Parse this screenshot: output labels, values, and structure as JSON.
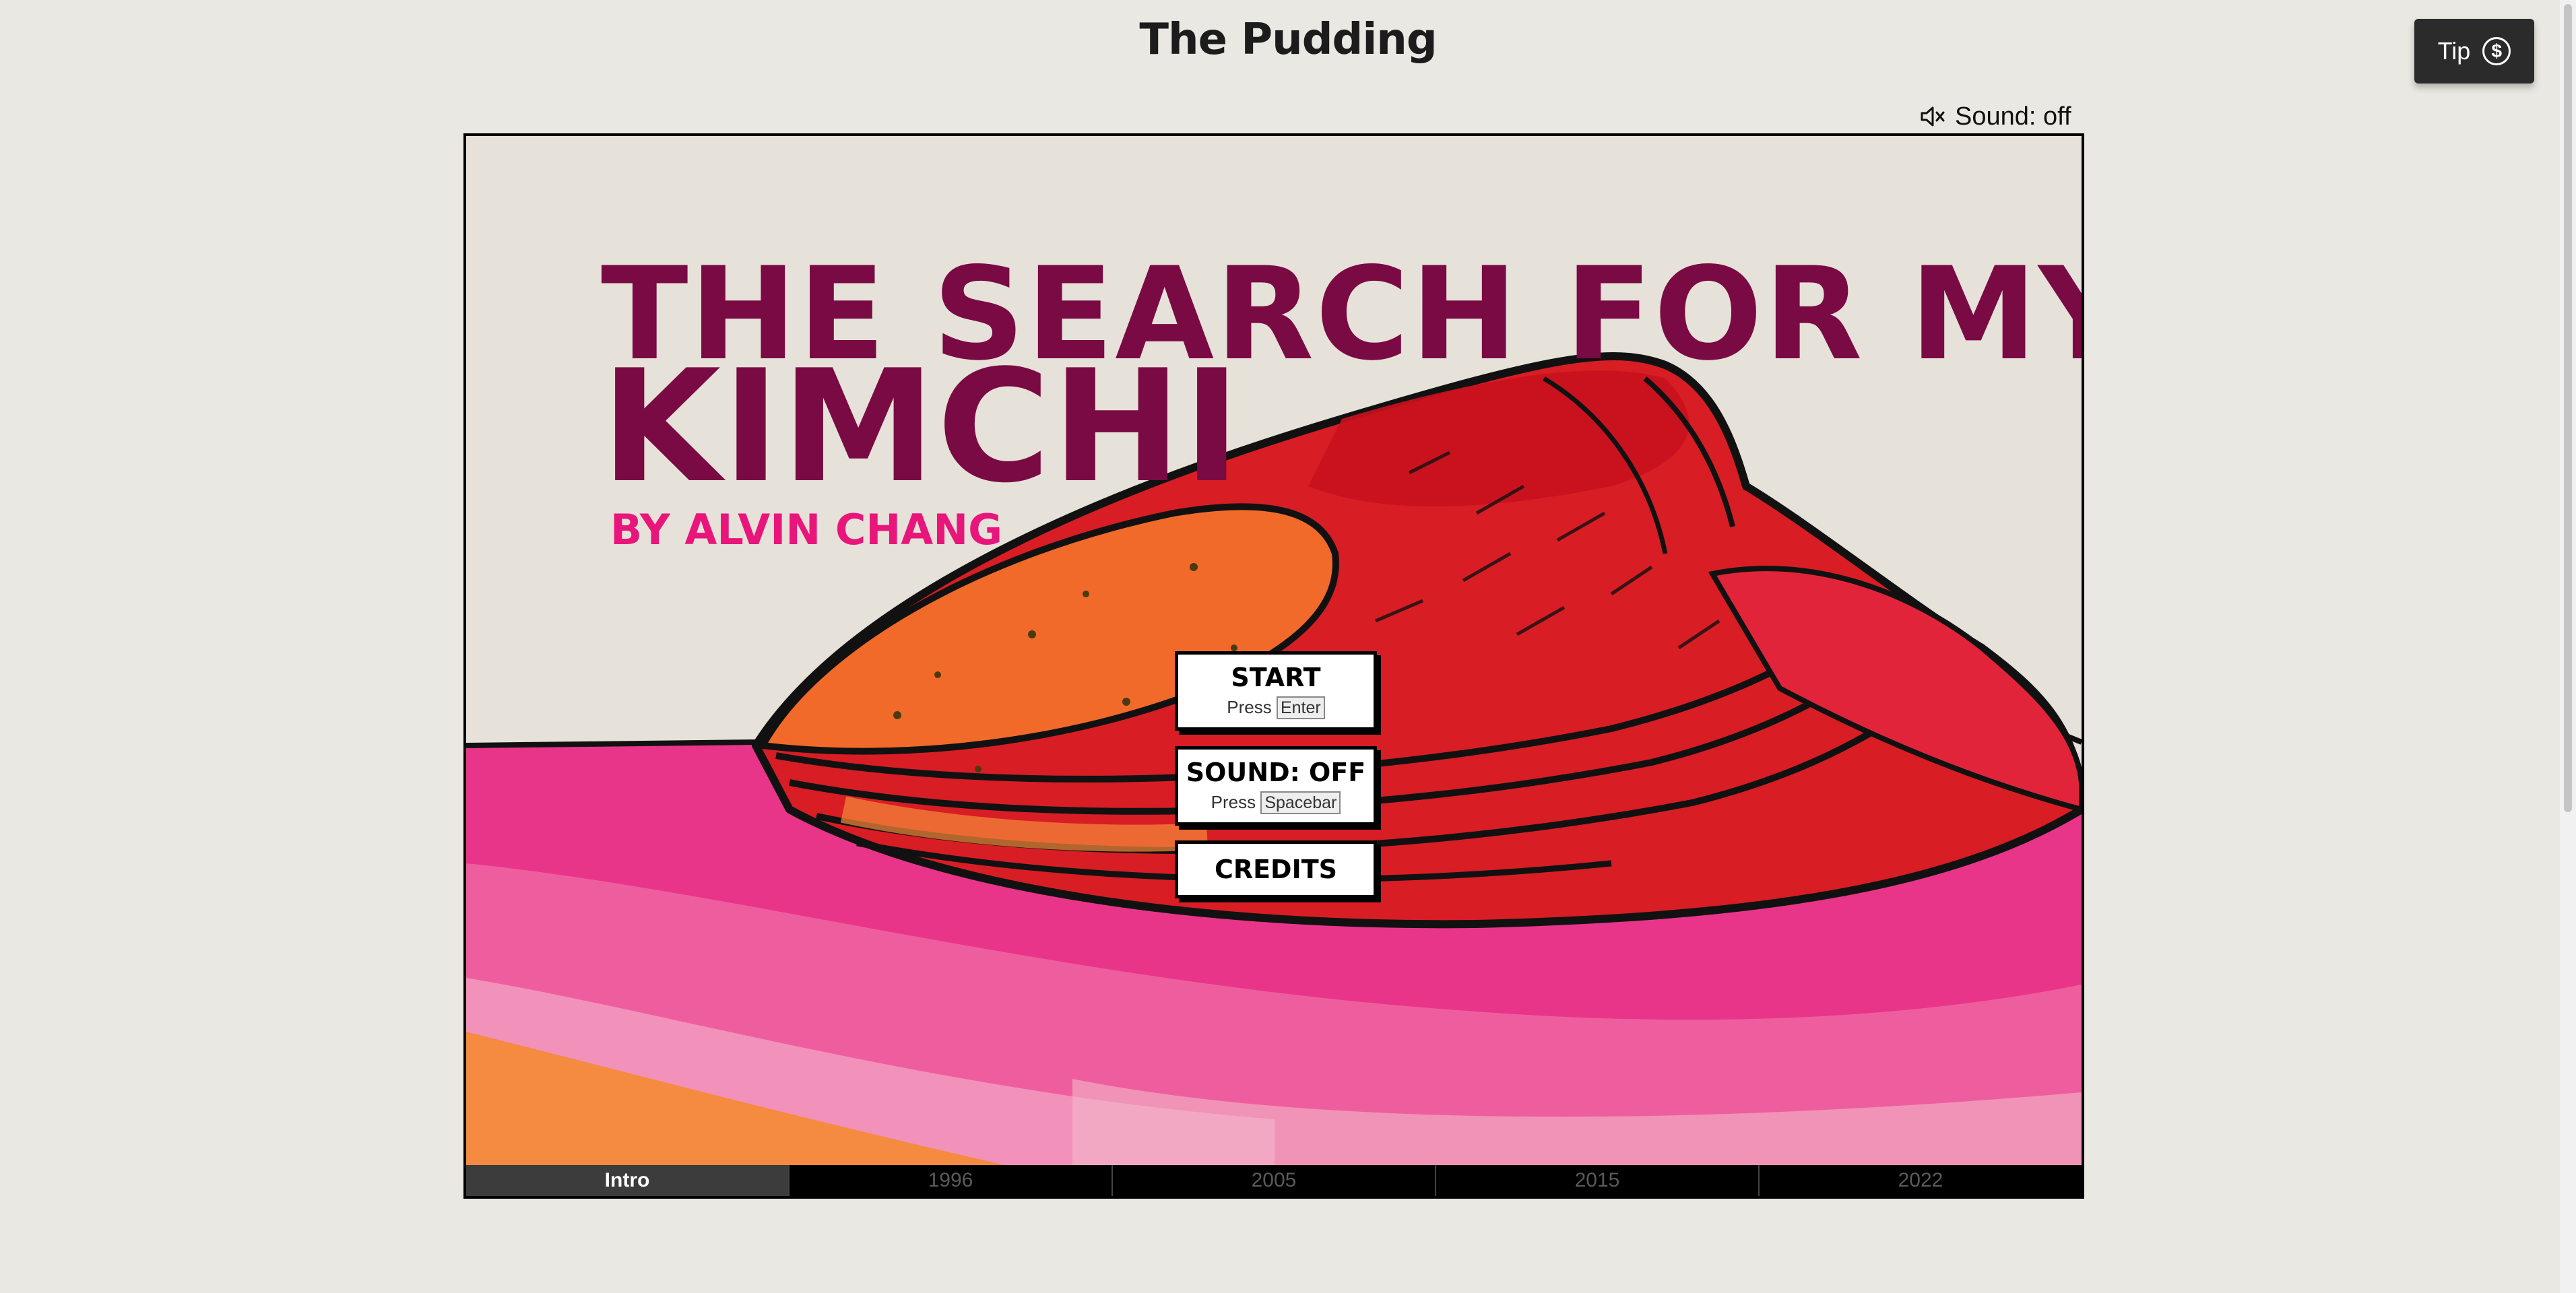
{
  "header": {
    "site_name": "The Pudding",
    "tip_label": "Tip",
    "tip_icon": "dollar-circle-icon",
    "sound_label": "Sound: off",
    "sound_icon": "speaker-muted-icon"
  },
  "game": {
    "title_line_1": "THE SEARCH FOR MY",
    "title_line_2": "KIMCHI",
    "byline": "BY ALVIN CHANG",
    "menu": {
      "start": {
        "label": "START",
        "hint_prefix": "Press",
        "key": "Enter"
      },
      "sound": {
        "label": "SOUND: OFF",
        "hint_prefix": "Press",
        "key": "Spacebar"
      },
      "credits": {
        "label": "CREDITS"
      }
    },
    "timeline": [
      {
        "label": "Intro",
        "active": true
      },
      {
        "label": "1996",
        "active": false
      },
      {
        "label": "2005",
        "active": false
      },
      {
        "label": "2015",
        "active": false
      },
      {
        "label": "2022",
        "active": false
      }
    ]
  },
  "colors": {
    "page_background": "#eae8e2",
    "title": "#7a0a43",
    "byline": "#e8167a",
    "kimchi_red": "#e01e1e",
    "kimchi_orange": "#f26a2a",
    "table_pink": "#e8358a"
  }
}
